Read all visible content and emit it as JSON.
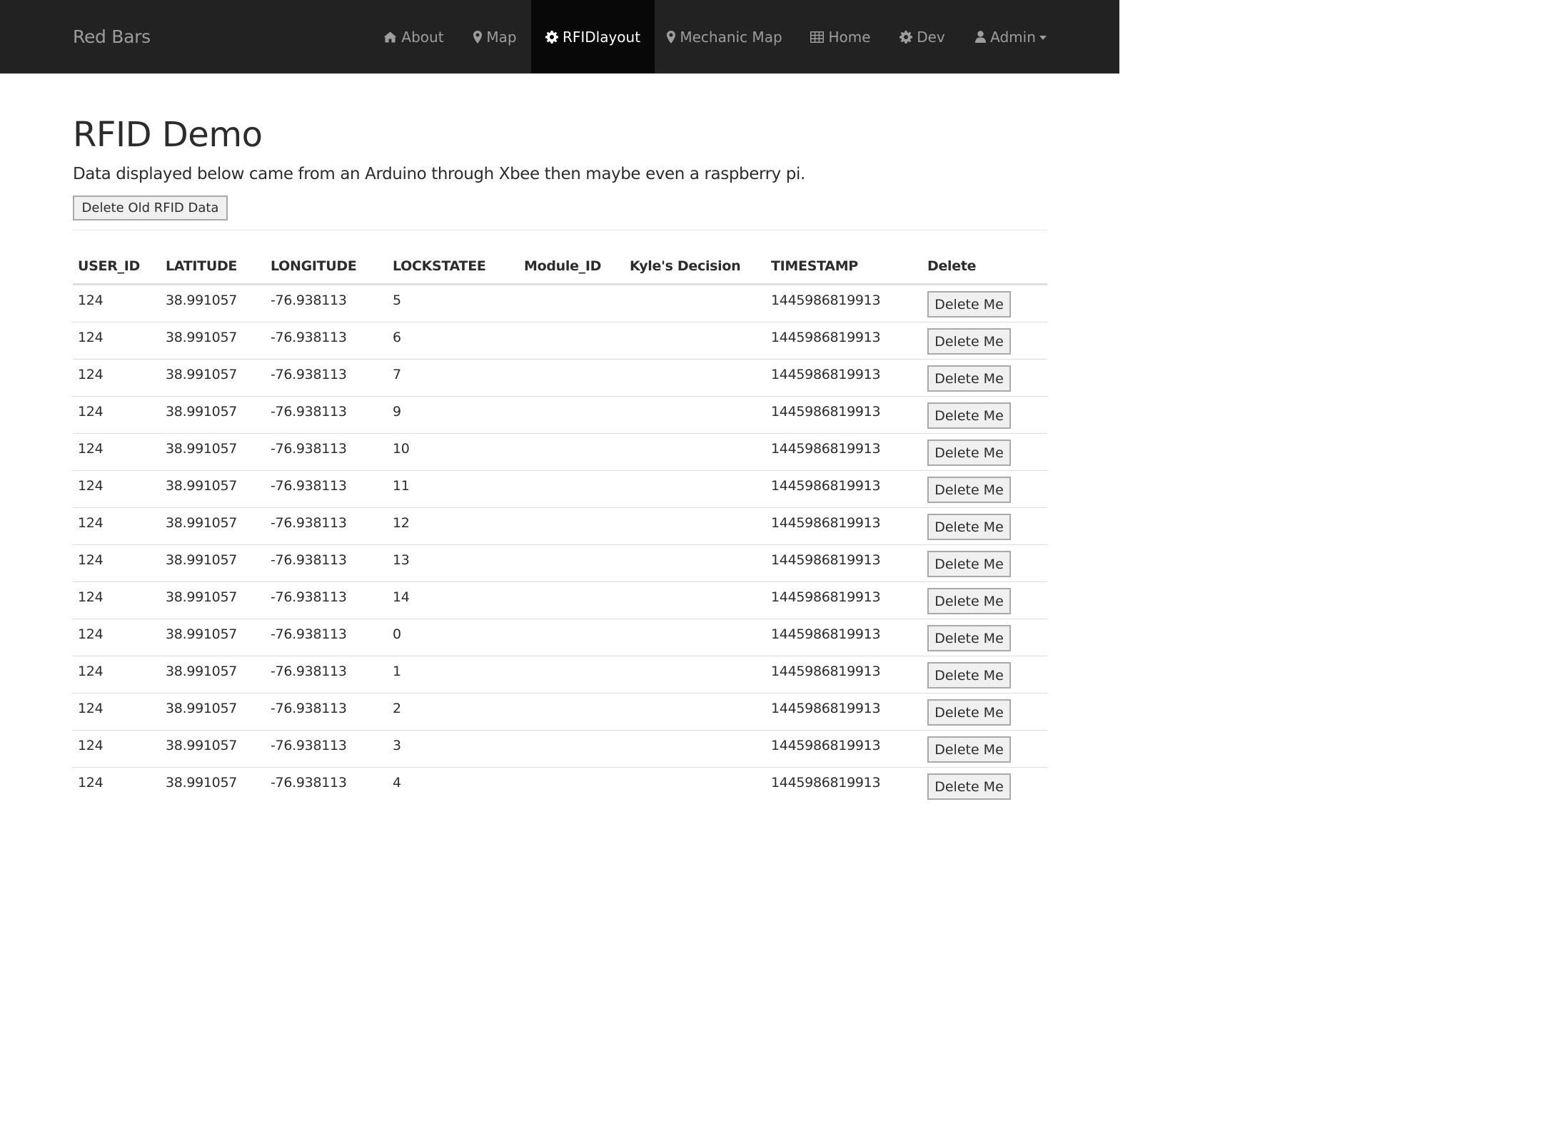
{
  "navbar": {
    "brand": "Red Bars",
    "items": [
      {
        "label": "About",
        "icon": "home-icon",
        "active": false
      },
      {
        "label": "Map",
        "icon": "map-marker-icon",
        "active": false
      },
      {
        "label": "RFIDlayout",
        "icon": "gear-icon",
        "active": true
      },
      {
        "label": "Mechanic Map",
        "icon": "map-marker-icon",
        "active": false
      },
      {
        "label": "Home",
        "icon": "table-icon",
        "active": false
      },
      {
        "label": "Dev",
        "icon": "gear-icon",
        "active": false
      },
      {
        "label": "Admin",
        "icon": "user-icon",
        "active": false,
        "dropdown": true
      }
    ]
  },
  "main": {
    "title": "RFID Demo",
    "lead": "Data displayed below came from an Arduino through Xbee then maybe even a raspberry pi.",
    "delete_old_label": "Delete Old RFID Data"
  },
  "table": {
    "headers": [
      "USER_ID",
      "LATITUDE",
      "LONGITUDE",
      "LOCKSTATEE",
      "Module_ID",
      "Kyle's Decision",
      "TIMESTAMP",
      "Delete"
    ],
    "delete_label": "Delete Me",
    "rows": [
      [
        "124",
        "38.991057",
        "-76.938113",
        "5",
        "",
        "",
        "1445986819913"
      ],
      [
        "124",
        "38.991057",
        "-76.938113",
        "6",
        "",
        "",
        "1445986819913"
      ],
      [
        "124",
        "38.991057",
        "-76.938113",
        "7",
        "",
        "",
        "1445986819913"
      ],
      [
        "124",
        "38.991057",
        "-76.938113",
        "9",
        "",
        "",
        "1445986819913"
      ],
      [
        "124",
        "38.991057",
        "-76.938113",
        "10",
        "",
        "",
        "1445986819913"
      ],
      [
        "124",
        "38.991057",
        "-76.938113",
        "11",
        "",
        "",
        "1445986819913"
      ],
      [
        "124",
        "38.991057",
        "-76.938113",
        "12",
        "",
        "",
        "1445986819913"
      ],
      [
        "124",
        "38.991057",
        "-76.938113",
        "13",
        "",
        "",
        "1445986819913"
      ],
      [
        "124",
        "38.991057",
        "-76.938113",
        "14",
        "",
        "",
        "1445986819913"
      ],
      [
        "124",
        "38.991057",
        "-76.938113",
        "0",
        "",
        "",
        "1445986819913"
      ],
      [
        "124",
        "38.991057",
        "-76.938113",
        "1",
        "",
        "",
        "1445986819913"
      ],
      [
        "124",
        "38.991057",
        "-76.938113",
        "2",
        "",
        "",
        "1445986819913"
      ],
      [
        "124",
        "38.991057",
        "-76.938113",
        "3",
        "",
        "",
        "1445986819913"
      ],
      [
        "124",
        "38.991057",
        "-76.938113",
        "4",
        "",
        "",
        "1445986819913"
      ]
    ]
  }
}
